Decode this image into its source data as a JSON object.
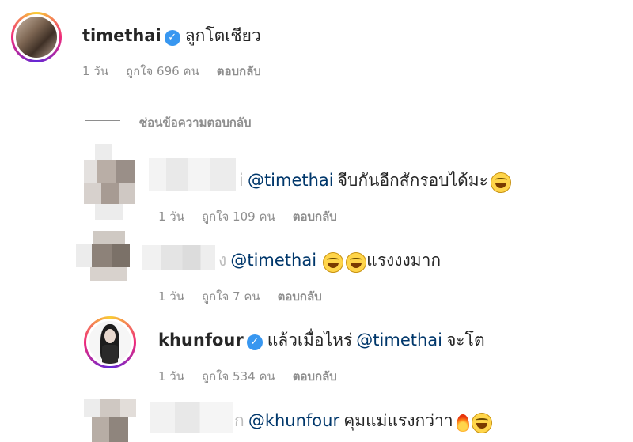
{
  "top_comment": {
    "username": "timethai",
    "text": "ลูกโตเชียว",
    "time": "1 วัน",
    "likes": "ถูกใจ 696 คน",
    "reply_label": "ตอบกลับ"
  },
  "hide_replies_label": "ซ่อนข้อความตอบกลับ",
  "replies": [
    {
      "username_suffix": "i",
      "mention": "@timethai",
      "text": "จีบกันอีกสักรอบได้มะ",
      "time": "1 วัน",
      "likes": "ถูกใจ 109 คน",
      "reply_label": "ตอบกลับ"
    },
    {
      "username_suffix": "ง",
      "mention": "@timethai",
      "text": "แรงงงมาก",
      "time": "1 วัน",
      "likes": "ถูกใจ 7 คน",
      "reply_label": "ตอบกลับ"
    },
    {
      "username": "khunfour",
      "text": "แล้วเมื่อไหร่",
      "mention": "@timethai",
      "text2": "จะโต",
      "time": "1 วัน",
      "likes": "ถูกใจ 534 คน",
      "reply_label": "ตอบกลับ"
    },
    {
      "username_suffix": "ก",
      "mention": "@khunfour",
      "text": "คุมแม่แรงกว่าา"
    }
  ],
  "colors": {
    "text": "#262626",
    "meta": "#8e8e8e",
    "mention": "#00376b",
    "verified": "#3897f0"
  }
}
